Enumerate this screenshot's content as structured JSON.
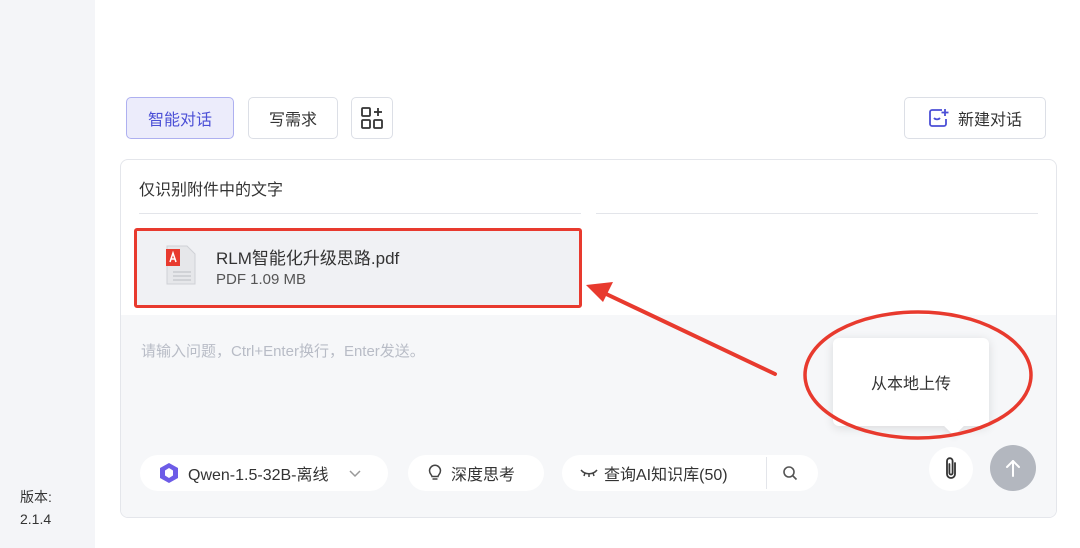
{
  "tabs": {
    "smart_chat": "智能对话",
    "write_req": "写需求"
  },
  "new_chat_label": "新建对话",
  "panel": {
    "hint": "仅识别附件中的文字",
    "placeholder": "请输入问题，Ctrl+Enter换行，Enter发送。"
  },
  "file": {
    "name": "RLM智能化升级思路.pdf",
    "meta": "PDF 1.09 MB"
  },
  "toolbar": {
    "model": "Qwen-1.5-32B-离线",
    "deep_think": "深度思考",
    "kb": "查询AI知识库(50)"
  },
  "tooltip": "从本地上传",
  "version": {
    "label": "版本:",
    "value": "2.1.4"
  },
  "colors": {
    "accent": "#4b4fd6",
    "annotation_red": "#e83a2e"
  },
  "icons": [
    "grid-add-icon",
    "new-chat-icon",
    "pdf-file-icon",
    "model-logo-icon",
    "chevron-down-icon",
    "bulb-icon",
    "eye-closed-icon",
    "search-icon",
    "paperclip-icon",
    "send-arrow-icon"
  ]
}
